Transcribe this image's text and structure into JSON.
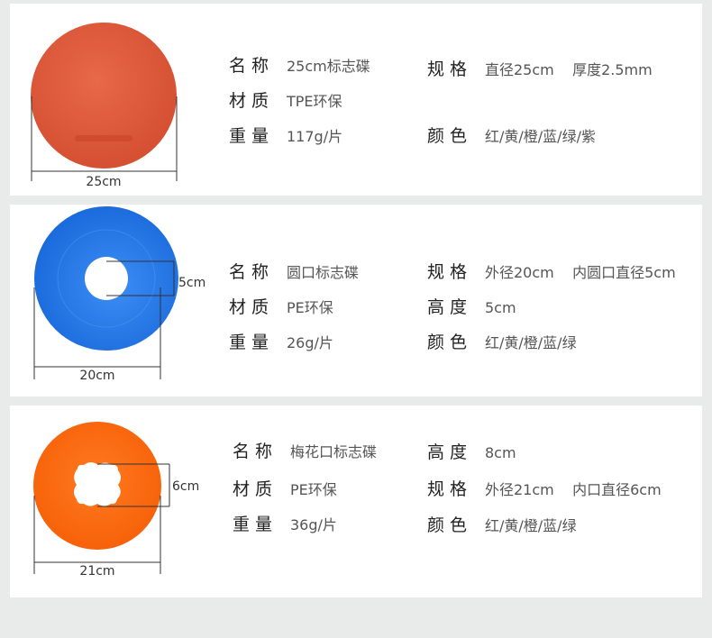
{
  "products": [
    {
      "dimension": "25cm",
      "color": "#e0593a",
      "rows": [
        [
          {
            "label": "名称",
            "value": "25cm标志碟"
          },
          {
            "label": "规格",
            "value": "直径25cm    厚度2.5mm"
          }
        ],
        [
          {
            "label": "材质",
            "value": "TPE环保"
          }
        ],
        [
          {
            "label": "重量",
            "value": "117g/片"
          },
          {
            "label": "颜色",
            "value": "红/黄/橙/蓝/绿/紫"
          }
        ]
      ]
    },
    {
      "dimension": "20cm",
      "inner_dimension": "5cm",
      "color": "#1a72e6",
      "rows": [
        [
          {
            "label": "名称",
            "value": "圆口标志碟"
          },
          {
            "label": "规格",
            "value": "外径20cm    内圆口直径5cm"
          }
        ],
        [
          {
            "label": "材质",
            "value": "PE环保"
          },
          {
            "label": "高度",
            "value": "5cm"
          }
        ],
        [
          {
            "label": "重量",
            "value": "26g/片"
          },
          {
            "label": "颜色",
            "value": "红/黄/橙/蓝/绿"
          }
        ]
      ]
    },
    {
      "dimension": "21cm",
      "inner_dimension": "6cm",
      "color": "#ff6a10",
      "rows": [
        [
          {
            "label": "名称",
            "value": "梅花口标志碟"
          },
          {
            "label": "高度",
            "value": "8cm"
          }
        ],
        [
          {
            "label": "材质",
            "value": "PE环保"
          },
          {
            "label": "规格",
            "value": "外径21cm    内口直径6cm"
          }
        ],
        [
          {
            "label": "重量",
            "value": "36g/片"
          },
          {
            "label": "颜色",
            "value": "红/黄/橙/蓝/绿"
          }
        ]
      ]
    }
  ]
}
